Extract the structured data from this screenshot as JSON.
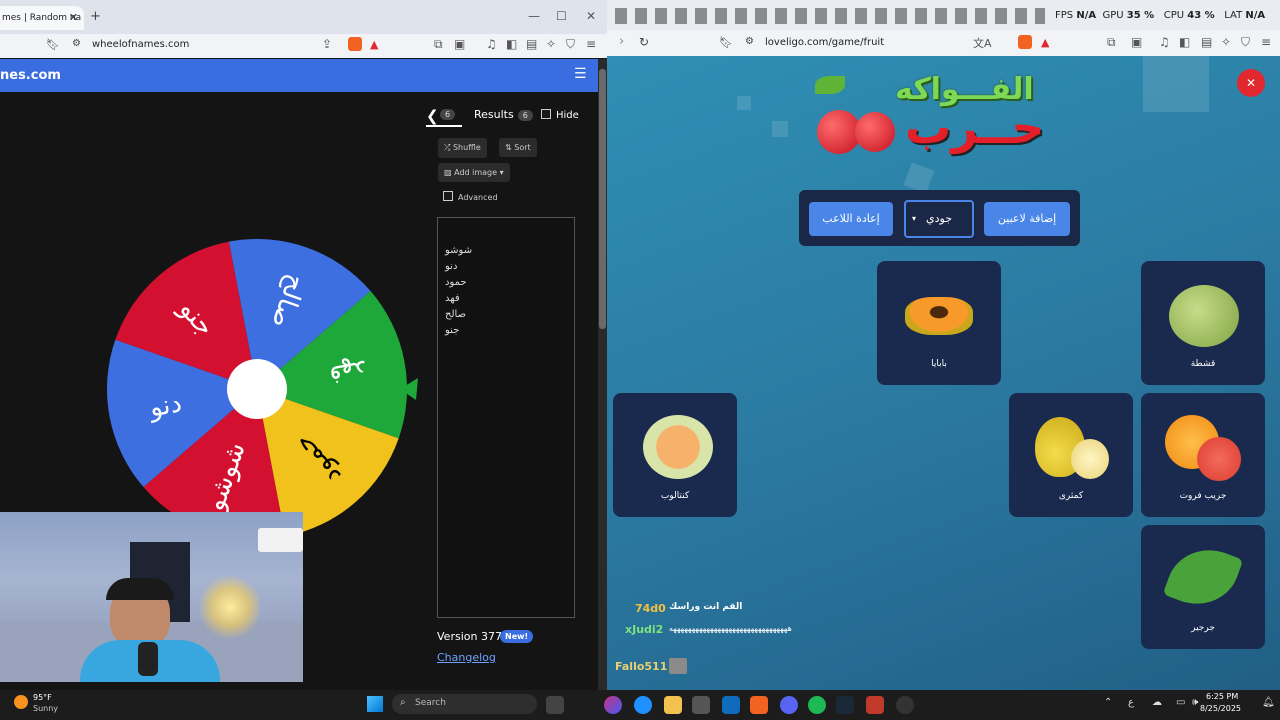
{
  "left_browser": {
    "tab_title": "mes | Random na",
    "url": "wheelofnames.com",
    "brand": "nes.com",
    "panel": {
      "entries_count": "6",
      "results_label": "Results",
      "results_count": "6",
      "hide_label": "Hide",
      "shuffle_label": "Shuffle",
      "sort_label": "Sort",
      "add_image_label": "Add image",
      "advanced_label": "Advanced",
      "names": [
        "شوشو",
        "دنو",
        "حمود",
        "فهد",
        "صالح",
        "جنو"
      ],
      "version_label": "Version 377",
      "new_badge": "New!",
      "changelog_label": "Changelog"
    },
    "wheel": {
      "segments": [
        {
          "label": "صالح",
          "color": "#3e6fe0"
        },
        {
          "label": "فهد",
          "color": "#1fa83a"
        },
        {
          "label": "حمود",
          "color": "#f1c21b"
        },
        {
          "label": "شوشو",
          "color": "#d3102f"
        },
        {
          "label": "دنو",
          "color": "#3e6fe0"
        },
        {
          "label": "جنو",
          "color": "#d3102f"
        }
      ]
    }
  },
  "right_browser": {
    "url": "loveligo.com/game/fruit",
    "game_title_top": "الفـــواكه",
    "game_title_bottom": "حــرب",
    "buttons": {
      "add_players": "إضافة لاعبين",
      "player_select": "جودي",
      "reset_player": "إعادة اللاعب"
    },
    "cards": [
      {
        "label": "بابايا"
      },
      {
        "label": "قشطة"
      },
      {
        "label": "كنتالوب"
      },
      {
        "label": "كمثرى"
      },
      {
        "label": "جريب فروت"
      },
      {
        "label": "جرجير"
      }
    ],
    "chat": [
      {
        "user": "74d0",
        "message": "القم انت وراسك",
        "color": "#f0c040"
      },
      {
        "user": "xJudi2",
        "message": "ههههههههههههههههههههههههههههههههه",
        "color": "#7fe07f"
      },
      {
        "user": "Fallo511",
        "message": "",
        "color": "#e8d070"
      }
    ],
    "stats": {
      "fps_label": "FPS",
      "fps_value": "N/A",
      "gpu_label": "GPU",
      "gpu_value": "35 %",
      "cpu_label": "CPU",
      "cpu_value": "43 %",
      "lat_label": "LAT",
      "lat_value": "N/A"
    }
  },
  "taskbar": {
    "weather_temp": "95°F",
    "weather_desc": "Sunny",
    "search_placeholder": "Search",
    "time": "6:25 PM",
    "date": "8/25/2025"
  }
}
